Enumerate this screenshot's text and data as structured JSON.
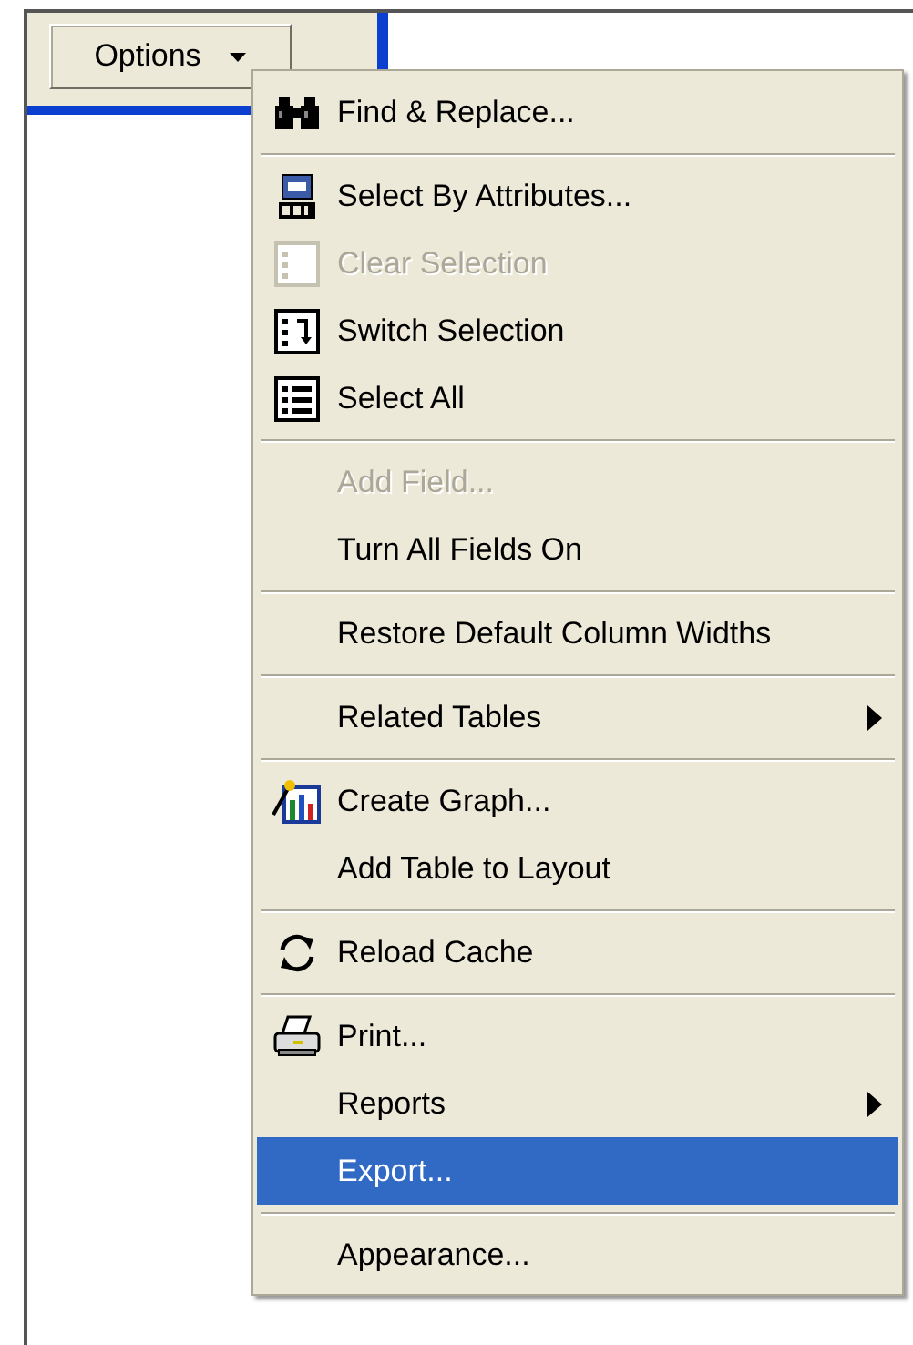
{
  "toolbar": {
    "options_button": {
      "label": "Options",
      "expanded": true
    }
  },
  "menu": {
    "items": [
      {
        "kind": "command",
        "label": "Find & Replace...",
        "disabled": false,
        "selected": false
      },
      {
        "kind": "separator"
      },
      {
        "kind": "command",
        "label": "Select By Attributes...",
        "disabled": false,
        "selected": false
      },
      {
        "kind": "command",
        "label": "Clear Selection",
        "disabled": true,
        "selected": false
      },
      {
        "kind": "command",
        "label": "Switch Selection",
        "disabled": false,
        "selected": false
      },
      {
        "kind": "command",
        "label": "Select All",
        "disabled": false,
        "selected": false
      },
      {
        "kind": "separator"
      },
      {
        "kind": "command",
        "label": "Add Field...",
        "disabled": true,
        "selected": false
      },
      {
        "kind": "command",
        "label": "Turn All Fields On",
        "disabled": false,
        "selected": false
      },
      {
        "kind": "separator"
      },
      {
        "kind": "command",
        "label": "Restore Default Column Widths",
        "disabled": false,
        "selected": false
      },
      {
        "kind": "separator"
      },
      {
        "kind": "submenu",
        "label": "Related Tables",
        "disabled": false,
        "selected": false
      },
      {
        "kind": "separator"
      },
      {
        "kind": "command",
        "label": "Create Graph...",
        "disabled": false,
        "selected": false
      },
      {
        "kind": "command",
        "label": "Add Table to Layout",
        "disabled": false,
        "selected": false
      },
      {
        "kind": "separator"
      },
      {
        "kind": "command",
        "label": "Reload Cache",
        "disabled": false,
        "selected": false
      },
      {
        "kind": "separator"
      },
      {
        "kind": "command",
        "label": "Print...",
        "disabled": false,
        "selected": false
      },
      {
        "kind": "submenu",
        "label": "Reports",
        "disabled": false,
        "selected": false
      },
      {
        "kind": "command",
        "label": "Export...",
        "disabled": false,
        "selected": true
      },
      {
        "kind": "separator"
      },
      {
        "kind": "command",
        "label": "Appearance...",
        "disabled": false,
        "selected": false
      }
    ]
  }
}
